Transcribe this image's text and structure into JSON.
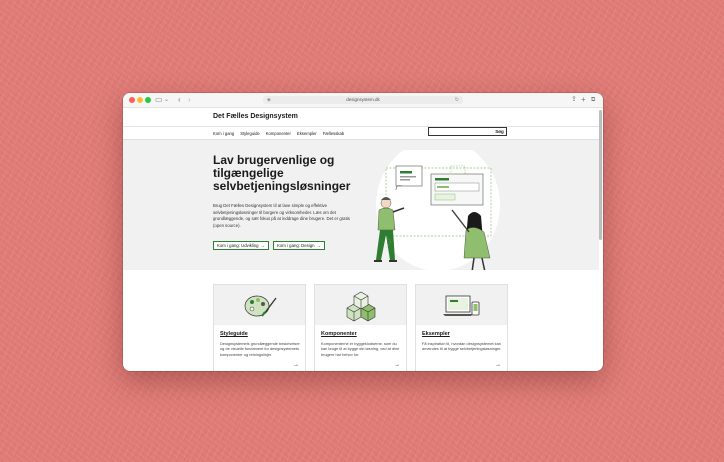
{
  "browser": {
    "address": "designsystem.dk",
    "icons": [
      "sidebar-icon",
      "chevron-down-icon",
      "back-icon",
      "forward-icon",
      "shield-icon",
      "reload-icon",
      "share-icon",
      "new-tab-icon",
      "tabs-icon"
    ]
  },
  "site": {
    "logo": "Det Fælles Designsystem",
    "nav": [
      "Kom i gang",
      "Styleguide",
      "Komponenter",
      "Eksempler",
      "Fællesskab"
    ],
    "search": {
      "placeholder": "",
      "button": "Søg"
    }
  },
  "hero": {
    "title": "Lav brugervenlige og tilgængelige selvbetjeningsløsninger",
    "text": "Brug Det Fælles Designsystem til at lave simple og effektive selvbetjeningsløsninger til borgere og virksomheder. Læs om det grundlæggende, og sæt fokus på at inddrage dine brugere. Det er gratis (open source).",
    "buttons": [
      {
        "label": "Kom i gang: Udvikling"
      },
      {
        "label": "Kom i gang: Design"
      }
    ]
  },
  "cards": [
    {
      "title": "Styleguide",
      "desc": "Designsystemets grundlæggende beskrivelser og de visuelle fundament for designsystemets komponenter og retningslinjer.",
      "icon": "palette-icon"
    },
    {
      "title": "Komponenter",
      "desc": "Komponenterne er byggeklodserne, som du kan bruge til at bygge din løsning, ved at dine brugere har behov for.",
      "icon": "blocks-icon"
    },
    {
      "title": "Eksempler",
      "desc": "Få inspiration til, hvordan designsystemet kan anvendes til at bygge selvbetjeningsløsninger.",
      "icon": "devices-icon"
    }
  ],
  "colors": {
    "accent": "#2e7d32",
    "green_light": "#8fbf6e",
    "background": "#df7b76"
  }
}
